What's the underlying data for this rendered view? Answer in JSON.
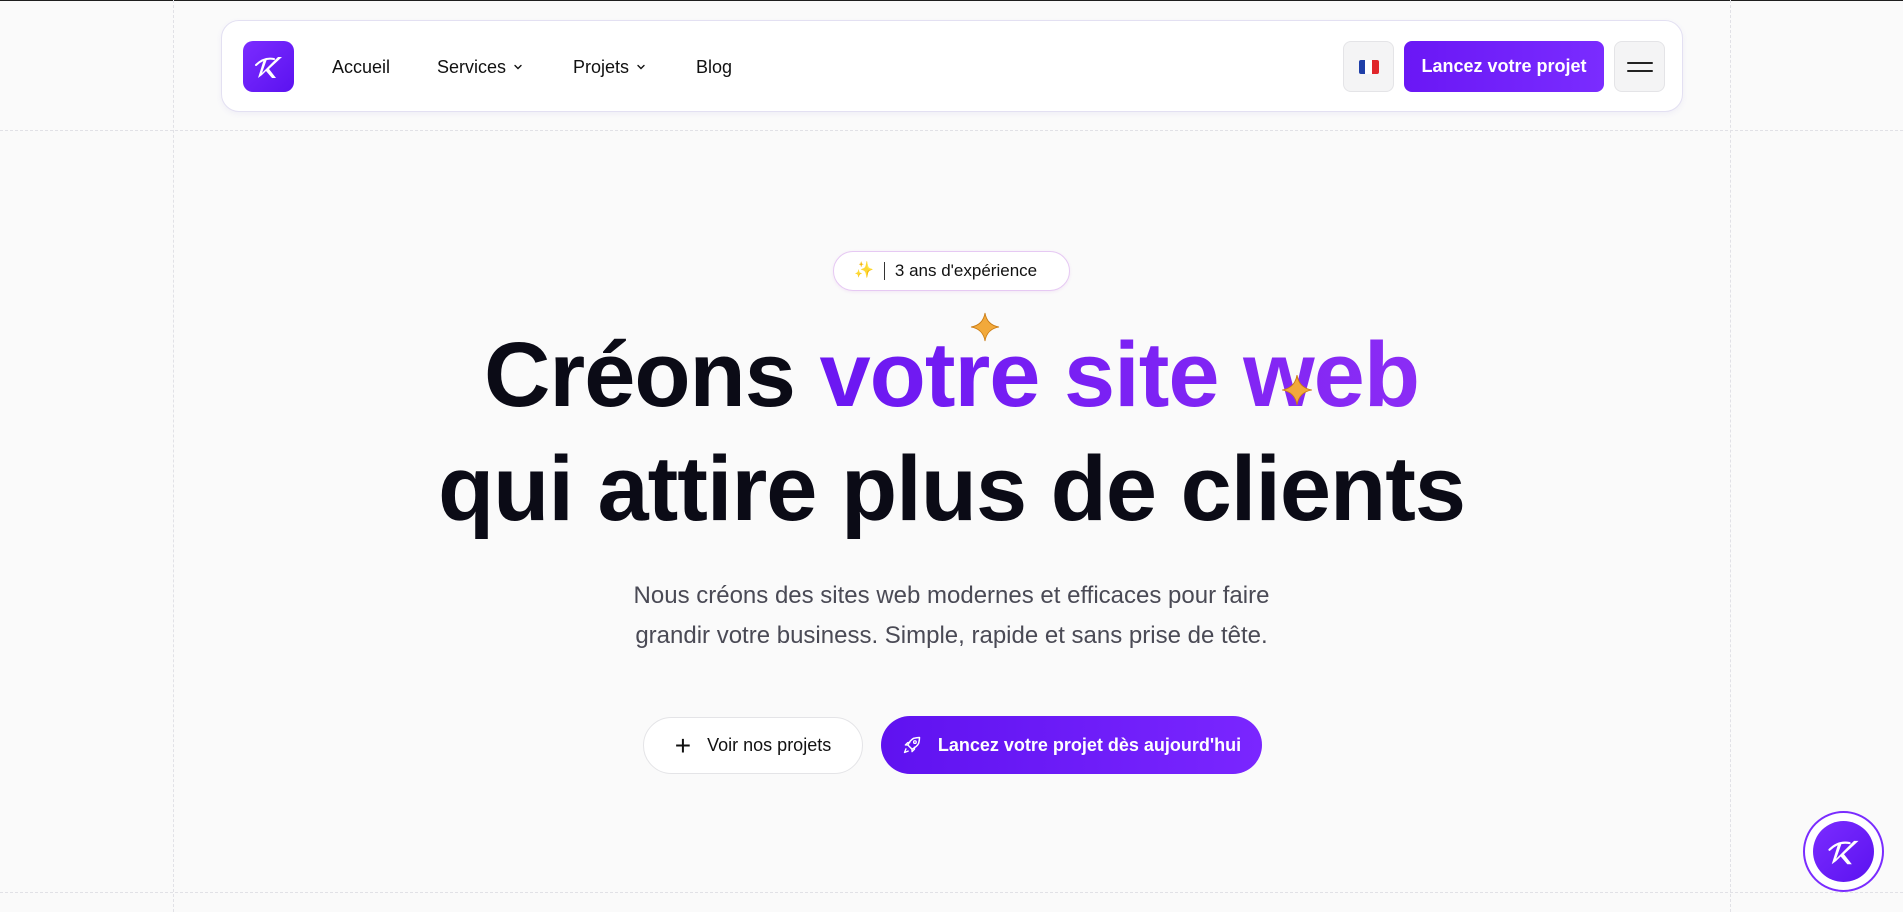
{
  "nav": {
    "logo_icon": "brand-k-logo",
    "links": [
      {
        "label": "Accueil",
        "has_dropdown": false
      },
      {
        "label": "Services",
        "has_dropdown": true
      },
      {
        "label": "Projets",
        "has_dropdown": true
      },
      {
        "label": "Blog",
        "has_dropdown": false
      }
    ],
    "language_flag": "fr-flag-icon",
    "cta_label": "Lancez votre projet",
    "menu_icon": "hamburger-menu-icon"
  },
  "hero": {
    "badge_icon": "sparkles-icon",
    "badge_text": "3 ans d'expérience",
    "headline_line1_plain": "Créons ",
    "headline_line1_accent": "votre site web",
    "headline_line2": "qui attire plus de clients",
    "subtitle_line1": "Nous créons des sites web modernes et efficaces pour faire",
    "subtitle_line2": "grandir votre business. Simple, rapide et sans prise de tête.",
    "secondary_button": "Voir nos projets",
    "primary_button": "Lancez votre projet dès aujourd'hui"
  },
  "colors": {
    "accent": "#7a1ff0",
    "primary_button": "#6a17f5",
    "sparkle": "#f2a93b",
    "headline": "#0b0b16",
    "body_text": "#4a4a55"
  }
}
